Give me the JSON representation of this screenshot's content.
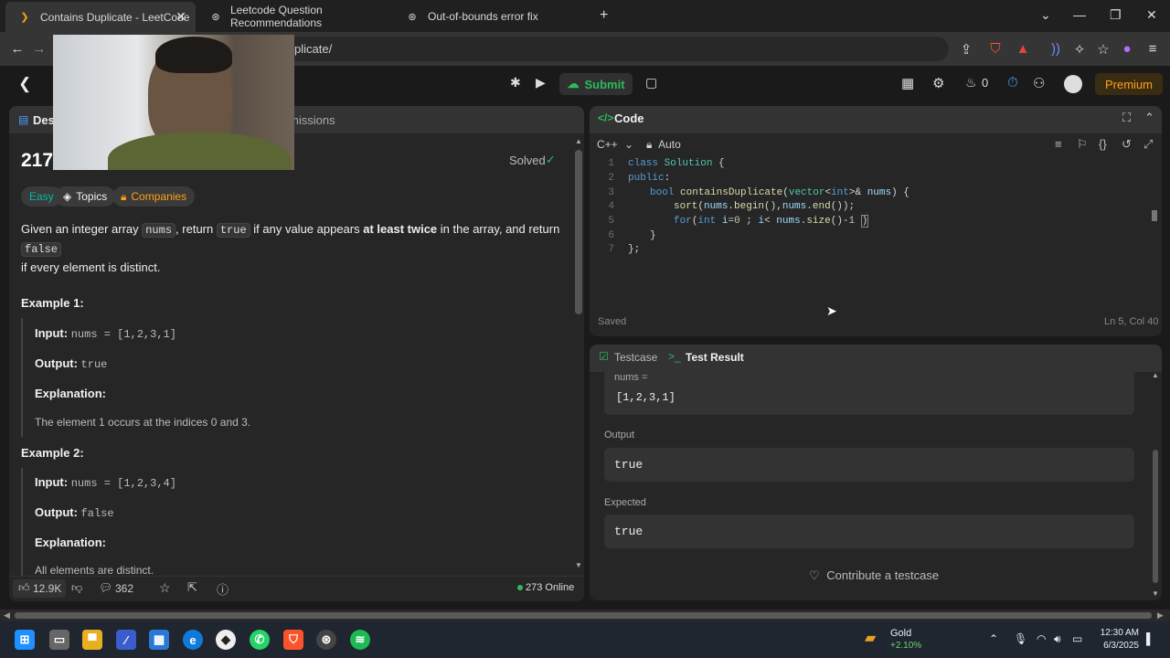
{
  "browser": {
    "tabs": [
      {
        "label": "Contains Duplicate - LeetCode",
        "icon": "leetcode-icon",
        "active": true
      },
      {
        "label": "Leetcode Question Recommendations",
        "icon": "chatgpt-icon",
        "active": false
      },
      {
        "label": "Out-of-bounds error fix",
        "icon": "chatgpt-icon",
        "active": false
      }
    ],
    "new_tab": "+",
    "url_suffix": "plicate/"
  },
  "nav": {
    "submit_label": "Submit",
    "streak_count": "0",
    "premium_label": "Premium"
  },
  "left": {
    "tab_desc": "Des",
    "tab_submissions": "missions",
    "title_prefix": "217",
    "solved_label": "Solved",
    "difficulty": "Easy",
    "topics": "Topics",
    "companies": "Companies",
    "desc_1": "Given an integer array ",
    "desc_nums": "nums",
    "desc_2": ", return ",
    "desc_true": "true",
    "desc_3": " if any value appears ",
    "desc_bold": "at least twice",
    "desc_4": " in the array, and return ",
    "desc_false": "false",
    "desc_5": "if every element is distinct.",
    "example1_title": "Example 1:",
    "ex1_input_label": "Input:",
    "ex1_input": "nums = [1,2,3,1]",
    "ex1_output_label": "Output:",
    "ex1_output": "true",
    "ex1_expl_label": "Explanation:",
    "ex1_expl": "The element 1 occurs at the indices 0 and 3.",
    "example2_title": "Example 2:",
    "ex2_input_label": "Input:",
    "ex2_input": "nums = [1,2,3,4]",
    "ex2_output_label": "Output:",
    "ex2_output": "false",
    "ex2_expl_label": "Explanation:",
    "ex2_expl": "All elements are distinct.",
    "likes": "12.9K",
    "comments": "362",
    "online": "273 Online"
  },
  "editor": {
    "header": "Code",
    "language": "C++",
    "mode": "Auto",
    "line_numbers": [
      "1",
      "2",
      "3",
      "4",
      "5",
      "6",
      "7"
    ],
    "status_saved": "Saved",
    "cursor_pos": "Ln 5, Col 40"
  },
  "result": {
    "tab_testcase": "Testcase",
    "tab_result": "Test Result",
    "input_label": "nums =",
    "input_value": "[1,2,3,1]",
    "output_label": "Output",
    "output_value": "true",
    "expected_label": "Expected",
    "expected_value": "true",
    "contribute": "Contribute a testcase"
  },
  "taskbar": {
    "widget_name": "Gold",
    "widget_change": "+2.10%",
    "time": "12:30 AM",
    "date": "6/3/2025"
  },
  "colors": {
    "accent_orange": "#ffa116",
    "easy_teal": "#00b8a3",
    "submit_green": "#2cbb5d",
    "online_green": "#2cbb5d"
  }
}
